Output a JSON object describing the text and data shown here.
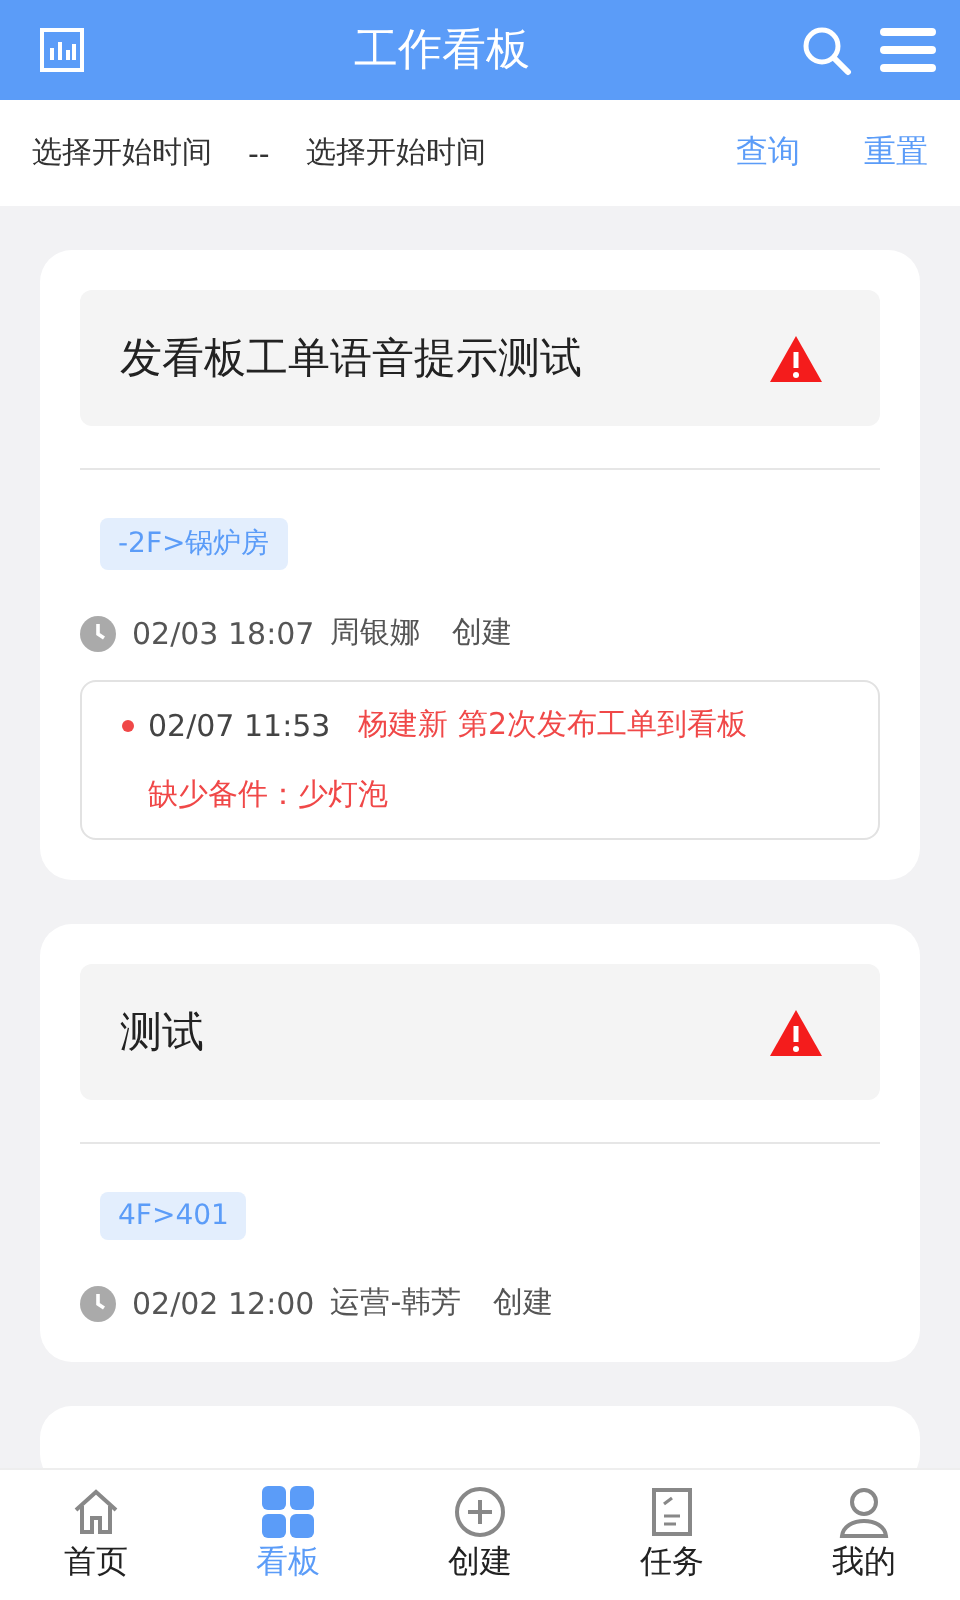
{
  "header": {
    "title": "工作看板"
  },
  "filter": {
    "start": "选择开始时间",
    "separator": "--",
    "end": "选择开始时间",
    "query": "查询",
    "reset": "重置"
  },
  "cards": [
    {
      "title": "发看板工单语音提示测试",
      "warning": true,
      "location": "-2F>锅炉房",
      "time": "02/03 18:07",
      "creator": "周银娜",
      "action": "创建",
      "logs": [
        {
          "time": "02/07 11:53",
          "message": "杨建新 第2次发布工单到看板",
          "note": "缺少备件：少灯泡"
        }
      ]
    },
    {
      "title": "测试",
      "warning": true,
      "location": "4F>401",
      "time": "02/02 12:00",
      "creator": "运营-韩芳",
      "action": "创建"
    }
  ],
  "nav": [
    {
      "kind": "home",
      "label": "首页",
      "selected": false
    },
    {
      "kind": "board",
      "label": "看板",
      "selected": true
    },
    {
      "kind": "create",
      "label": "创建",
      "selected": false
    },
    {
      "kind": "task",
      "label": "任务",
      "selected": false
    },
    {
      "kind": "me",
      "label": "我的",
      "selected": false
    }
  ]
}
